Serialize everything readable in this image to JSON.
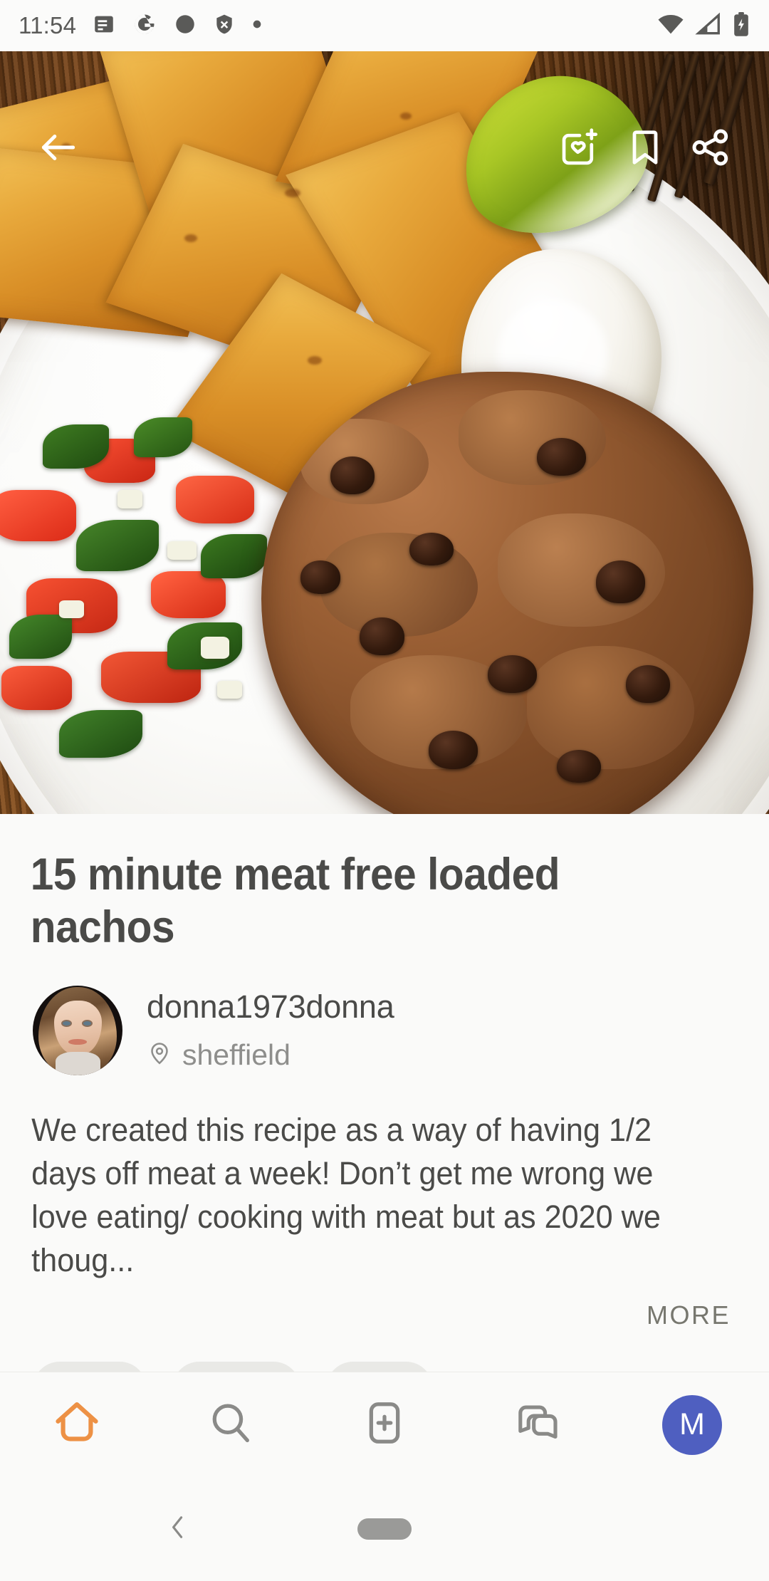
{
  "status_bar": {
    "time": "11:54",
    "left_icons": [
      "news-icon",
      "google-icon",
      "circle-icon",
      "shield-x-icon",
      "dot-icon"
    ],
    "right_icons": [
      "wifi-icon",
      "cellular-signal-icon",
      "battery-charging-icon"
    ]
  },
  "action_bar": {
    "back_label": "back-arrow-icon",
    "add_to_cookbook_label": "add-to-cookbook-icon",
    "bookmark_label": "bookmark-icon",
    "share_label": "share-icon"
  },
  "recipe": {
    "title": "15 minute meat free loaded nachos",
    "photo_alt": "loaded nachos with mince, beans, salsa, sour cream and lime on a white plate",
    "author": {
      "name": "donna1973donna",
      "location": "sheffield",
      "location_icon": "location-pin-icon",
      "avatar_alt": "profile photo of donna1973donna"
    },
    "description": "We created this recipe as a way of having 1/2 days off meat a week! Don’t get me wrong we love eating/ cooking with meat but as 2020 we thoug...",
    "more_label": "MORE",
    "tags": [
      "",
      "",
      ""
    ]
  },
  "bottom_nav": {
    "items": [
      {
        "name": "home",
        "icon": "home-icon",
        "active": true,
        "label": ""
      },
      {
        "name": "search",
        "icon": "search-icon",
        "active": false,
        "label": ""
      },
      {
        "name": "create",
        "icon": "add-recipe-icon",
        "active": false,
        "label": ""
      },
      {
        "name": "chat",
        "icon": "chat-bubbles-icon",
        "active": false,
        "label": ""
      },
      {
        "name": "profile",
        "icon": "profile-avatar",
        "active": false,
        "label": "M"
      }
    ]
  },
  "android_nav": {
    "back_icon": "nav-back-chevron-icon",
    "home_pill": "nav-home-pill"
  },
  "colors": {
    "accent_orange": "#ED9145",
    "avatar_blue": "#4F5FC0",
    "background": "#FAFAF9",
    "text_primary": "#4A4A48",
    "text_secondary": "#8E8E8C",
    "icon_grey": "#8A8A88"
  }
}
